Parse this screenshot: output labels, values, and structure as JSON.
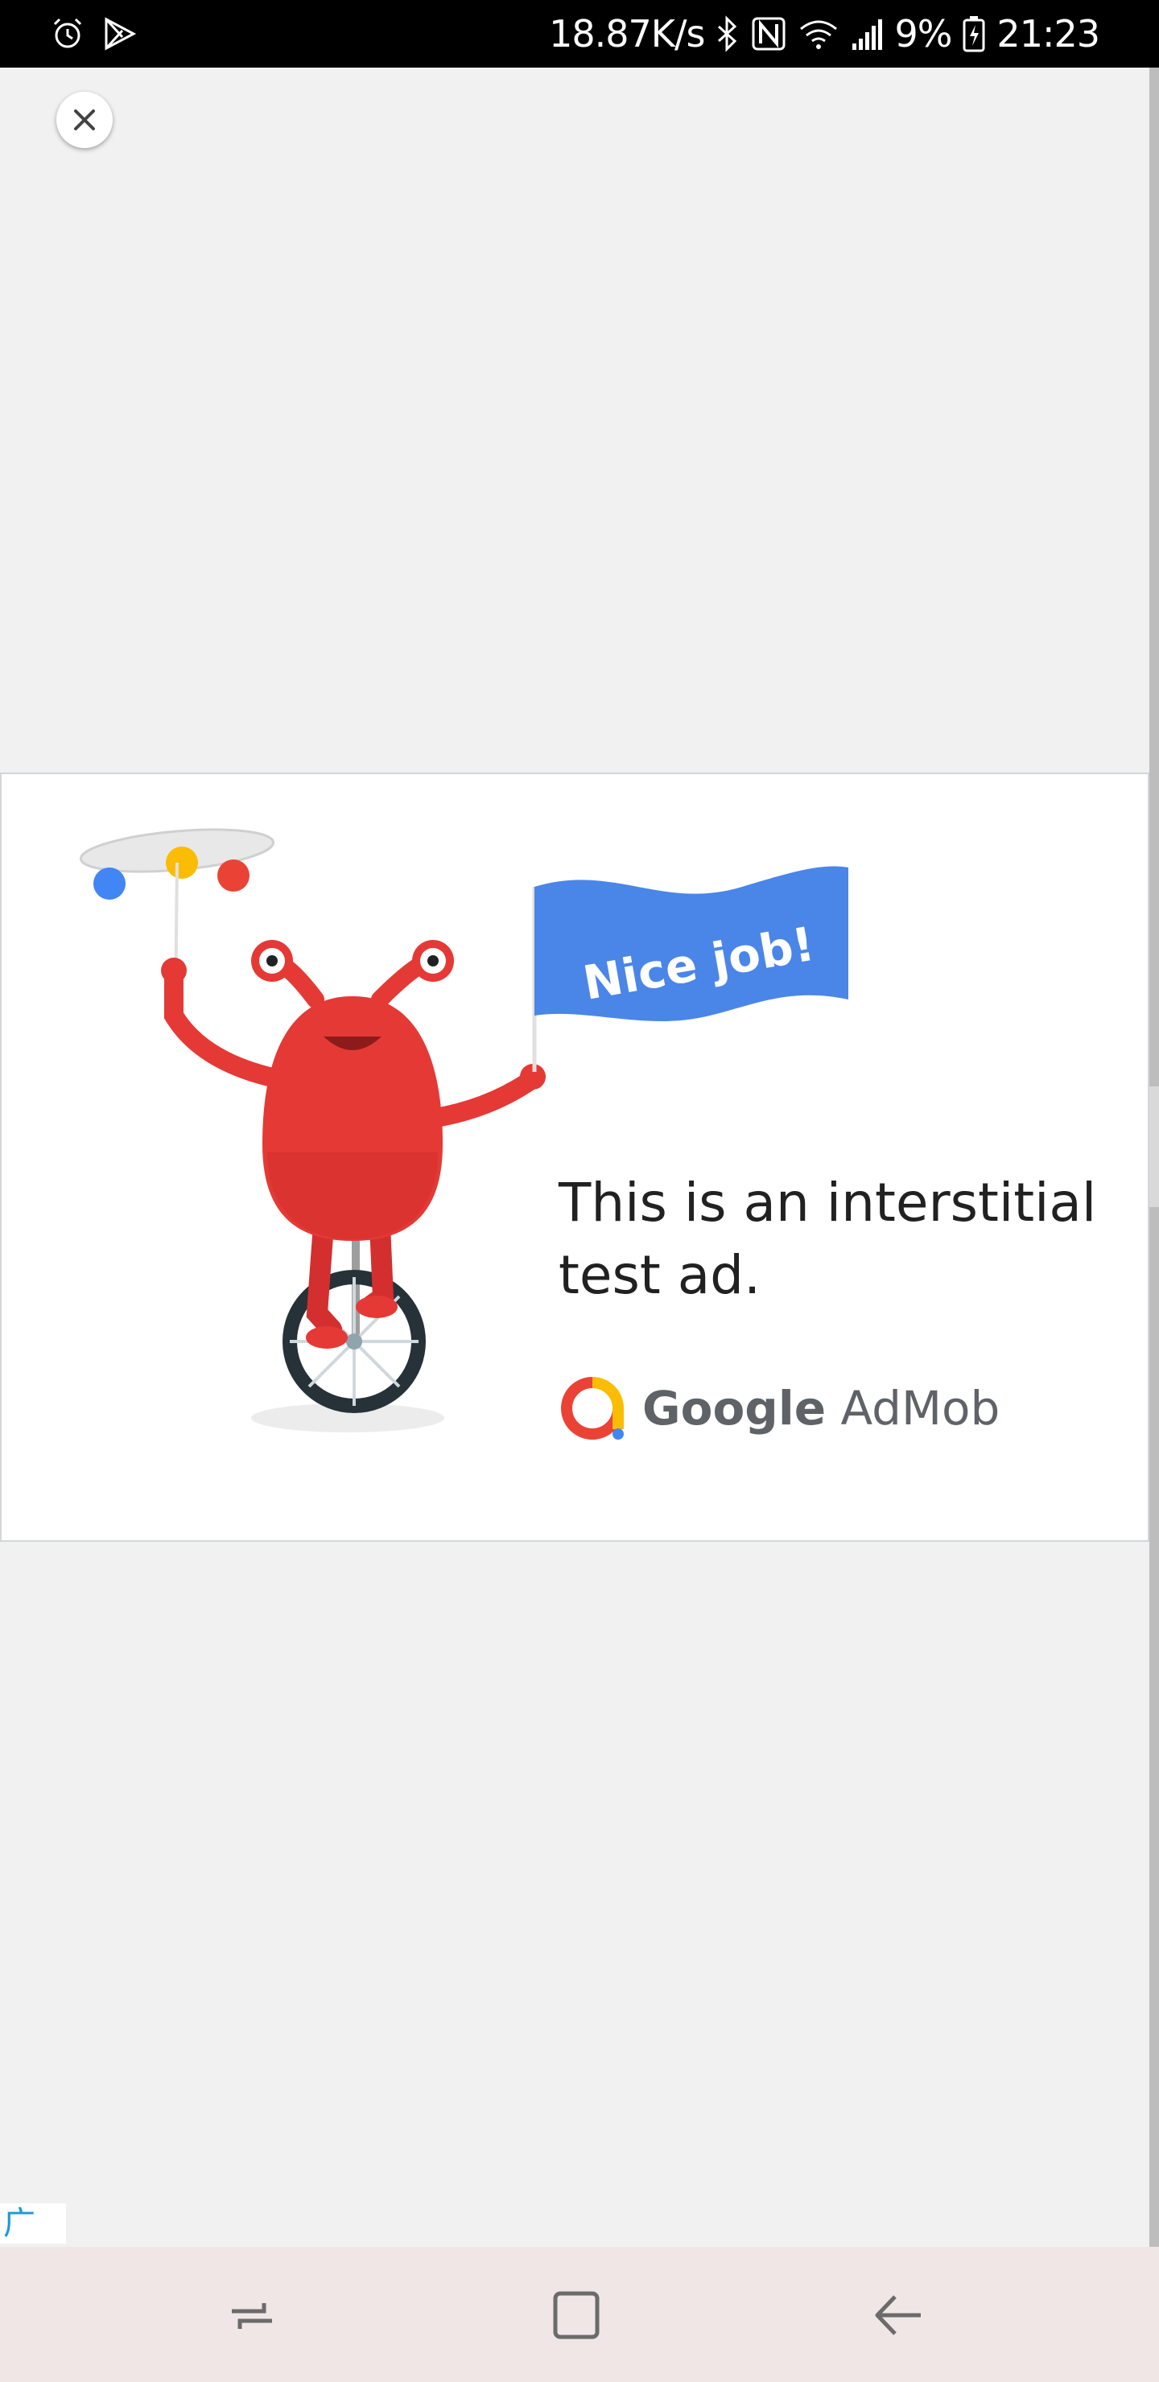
{
  "status_bar": {
    "network_speed": "18.87K/s",
    "battery_percent": "9%",
    "time": "21:23",
    "icons": [
      "alarm-icon",
      "play-store-icon",
      "bluetooth-icon",
      "nfc-icon",
      "wifi-icon",
      "signal-icon",
      "battery-icon"
    ]
  },
  "ad": {
    "flag_text": "Nice job!",
    "headline": "This is an interstitial test ad.",
    "brand_primary": "Google",
    "brand_secondary": "AdMob",
    "ad_label": "广告"
  },
  "nav": {
    "buttons": [
      "recent-apps",
      "home",
      "back"
    ]
  },
  "colors": {
    "flag_blue": "#4a86e8",
    "monster_red": "#e53935",
    "ball_blue": "#4285f4",
    "ball_yellow": "#fbbc04",
    "ball_red": "#ea4335",
    "ad_label_color": "#1a9bd6",
    "nav_bg": "#f1e6e6"
  }
}
